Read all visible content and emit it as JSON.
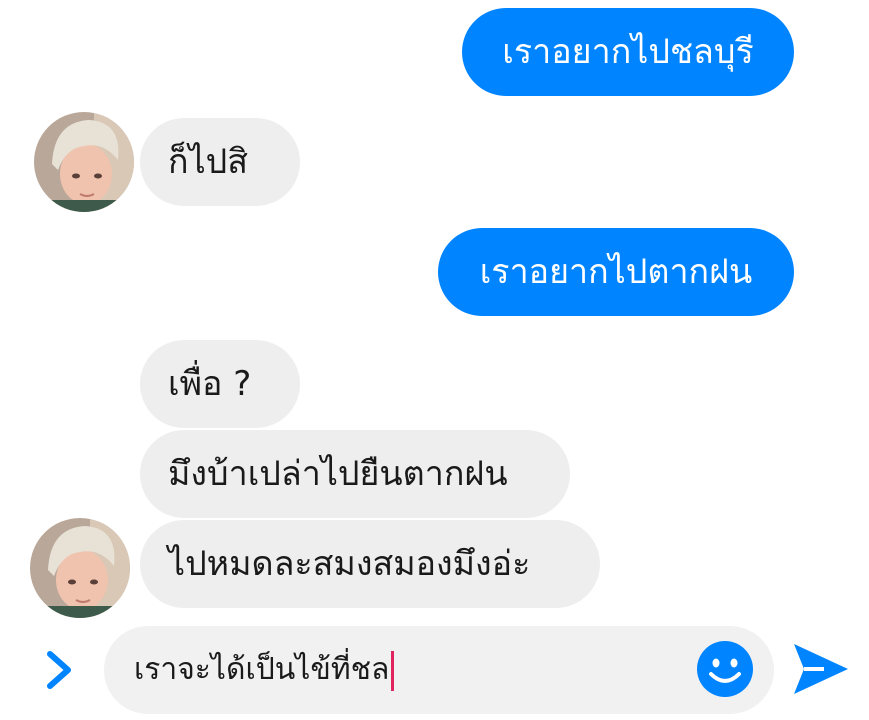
{
  "messages": [
    {
      "direction": "outgoing",
      "text": "เราอยากไปชลบุรี"
    },
    {
      "direction": "incoming",
      "text": "ก็ไปสิ"
    },
    {
      "direction": "outgoing",
      "text": "เราอยากไปตากฝน"
    },
    {
      "direction": "incoming",
      "text": "เพื่อ ?"
    },
    {
      "direction": "incoming",
      "text": "มึงบ้าเปล่าไปยืนตากฝน"
    },
    {
      "direction": "incoming",
      "text": "ไปหมดละสมงสมองมึงอ่ะ"
    }
  ],
  "composer": {
    "draft_text": "เราจะได้เป็นไข้ที่ชล",
    "expand_icon": "chevron-right-icon",
    "emoji_icon": "smiley-icon",
    "send_icon": "send-arrow-icon"
  },
  "colors": {
    "outgoing_bubble": "#0084ff",
    "incoming_bubble": "#eeeeef",
    "accent": "#0084ff",
    "caret": "#e0245e"
  }
}
